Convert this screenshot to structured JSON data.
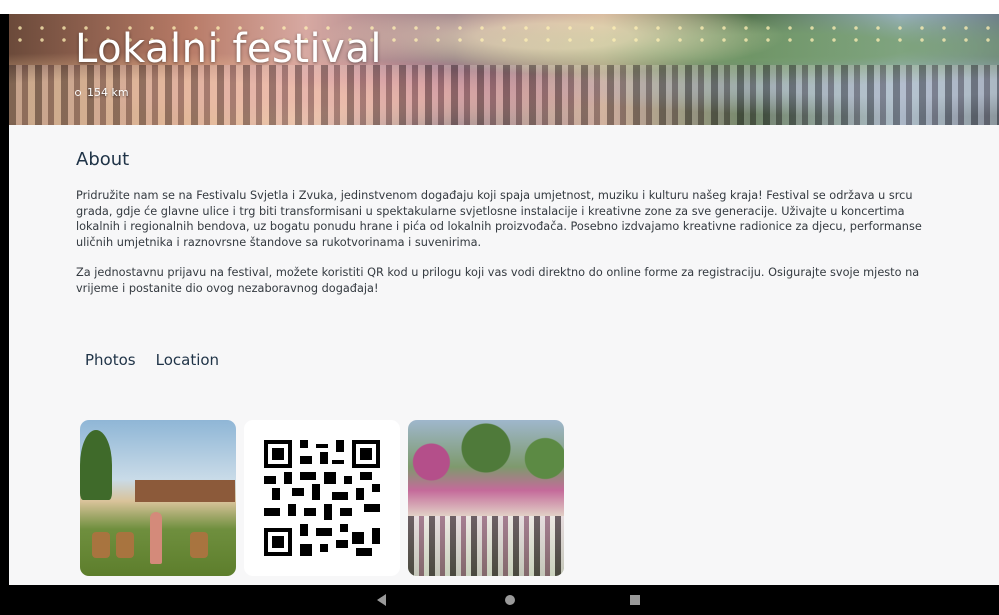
{
  "event": {
    "title": "Lokalni festival",
    "distance": "154 km"
  },
  "about": {
    "heading": "About",
    "paragraphs": [
      "Pridružite nam se na Festivalu Svjetla i Zvuka, jedinstvenom događaju koji spaja umjetnost, muziku i kulturu našeg kraja! Festival se održava u srcu grada, gdje će glavne ulice i trg biti transformisani u spektakularne svjetlosne instalacije i kreativne zone za sve generacije. Uživajte u koncertima lokalnih i regionalnih bendova, uz bogatu ponudu hrane i pića od lokalnih proizvođača. Posebno izdvajamo kreativne radionice za djecu, performanse uličnih umjetnika i raznovrsne štandove sa rukotvorinama i suvenirima.",
      "Za jednostavnu prijavu na festival, možete koristiti QR kod u prilogu koji vas vodi direktno do online forme za registraciju. Osigurajte svoje mjesto na vrijeme i postanite dio ovog nezaboravnog događaja!"
    ]
  },
  "tabs": [
    {
      "label": "Photos"
    },
    {
      "label": "Location"
    }
  ],
  "gallery": [
    {
      "kind": "photo"
    },
    {
      "kind": "qr-code"
    },
    {
      "kind": "photo"
    }
  ],
  "navigation": {
    "icons": [
      "back-icon",
      "home-icon",
      "recents-icon"
    ]
  },
  "colors": {
    "heading": "#1f3347",
    "body_text": "#343a40",
    "background": "#f7f7f8"
  }
}
